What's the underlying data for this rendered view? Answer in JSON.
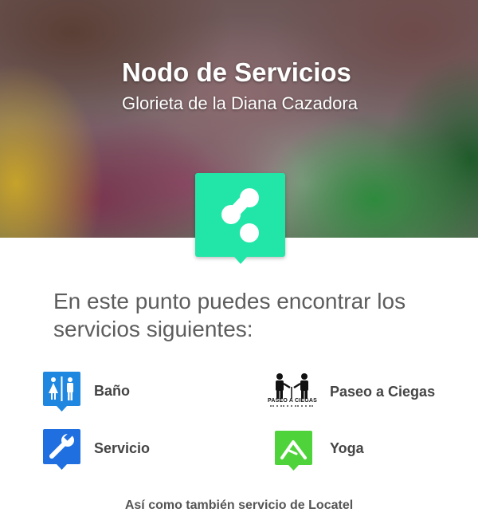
{
  "hero": {
    "title": "Nodo de Servicios",
    "subtitle": "Glorieta de la Diana Cazadora"
  },
  "node_badge": {
    "icon": "share-nodes-icon",
    "color": "#22e6a8"
  },
  "intro": "En este punto puedes encontrar los servicios siguientes:",
  "services": [
    {
      "label": "Baño",
      "icon": "restroom-icon",
      "color": "#1f87e0"
    },
    {
      "label": "Paseo a Ciegas",
      "icon": "blind-walk-icon",
      "icon_text": "PASEO A CIEGAS",
      "color": "#111111"
    },
    {
      "label": "Servicio",
      "icon": "wrench-icon",
      "color": "#1f6fe0"
    },
    {
      "label": "Yoga",
      "icon": "yoga-icon",
      "color": "#4fd33a"
    }
  ],
  "footer_note": "Así como también servicio de Locatel"
}
